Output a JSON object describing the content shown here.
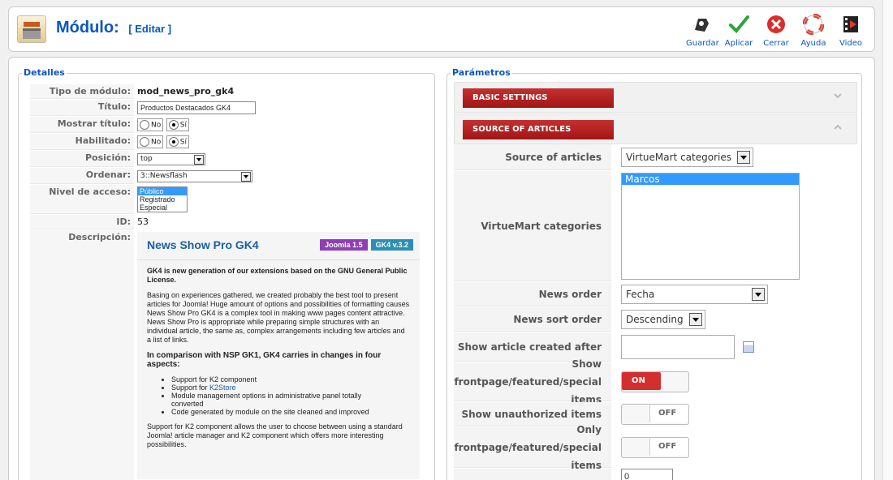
{
  "header": {
    "title": "Módulo:",
    "edit_label": "[ Editar ]",
    "tools": [
      {
        "label": "Guardar",
        "icon": "save-icon"
      },
      {
        "label": "Aplicar",
        "icon": "apply-check-icon"
      },
      {
        "label": "Cerrar",
        "icon": "close-icon"
      },
      {
        "label": "Ayuda",
        "icon": "help-lifebuoy-icon"
      },
      {
        "label": "Video",
        "icon": "video-film-icon"
      }
    ]
  },
  "details": {
    "legend": "Detalles",
    "labels": {
      "type": "Tipo de módulo:",
      "title": "Título:",
      "show_title": "Mostrar título:",
      "enabled": "Habilitado:",
      "position": "Posición:",
      "order": "Ordenar:",
      "access": "Nivel de acceso:",
      "id": "ID:",
      "description": "Descripción:"
    },
    "type_value": "mod_news_pro_gk4",
    "title_value": "Productos Destacados GK4",
    "no_label": "No",
    "yes_label": "Sí",
    "position_value": "top",
    "order_value": "3::Newsflash",
    "access_options": [
      "Público",
      "Registrado",
      "Especial"
    ],
    "id_value": "53",
    "desc": {
      "heading": "News Show Pro GK4",
      "badge_joomla": "Joomla 1.5",
      "badge_version": "GK4 v.3.2",
      "intro": "GK4 is new generation of our extensions based on the GNU General Public License.",
      "para1": "Basing on experiences gathered, we created probably the best tool to present articles for Joomla! Huge amount of options and possibilities of formatting causes News Show Pro GK4 is a complex tool in making www pages content attractive. News Show Pro is appropriate while preparing simple structures with an individual article, the same as, complex arrangements including few articles and a list of links.",
      "subheading": "In comparison with NSP GK1, GK4 carries in changes in four aspects:",
      "bullet1": "Support for K2 component",
      "bullet2_prefix": "Support for",
      "bullet2_link": "K2Store",
      "bullet3": "Module management options in administrative panel totally converted",
      "bullet4": "Code generated by module on the site cleaned and improved",
      "para2": "Support for K2 component allows the user to choose between using a standard Joomla! article manager and K2 component which offers more interesting possibilities."
    }
  },
  "params": {
    "legend": "Parámetros",
    "basic_settings": "BASIC SETTINGS",
    "source_of_articles": "SOURCE OF ARTICLES",
    "rows": {
      "source_label": "Source of articles",
      "source_value": "VirtueMart categories",
      "vm_label": "VirtueMart categories",
      "vm_items": [
        "Marcos"
      ],
      "order_label": "News order",
      "order_value": "Fecha",
      "sort_label": "News sort order",
      "sort_value": "Descending",
      "created_label": "Show article created after",
      "frontpage_label": "Show frontpage/featured/special items",
      "frontpage_value": "ON",
      "unauth_label": "Show unauthorized items",
      "unauth_value": "OFF",
      "only_fp_label": "Only frontpage/featured/special items",
      "only_fp_value": "OFF",
      "partial_value": "0"
    }
  }
}
